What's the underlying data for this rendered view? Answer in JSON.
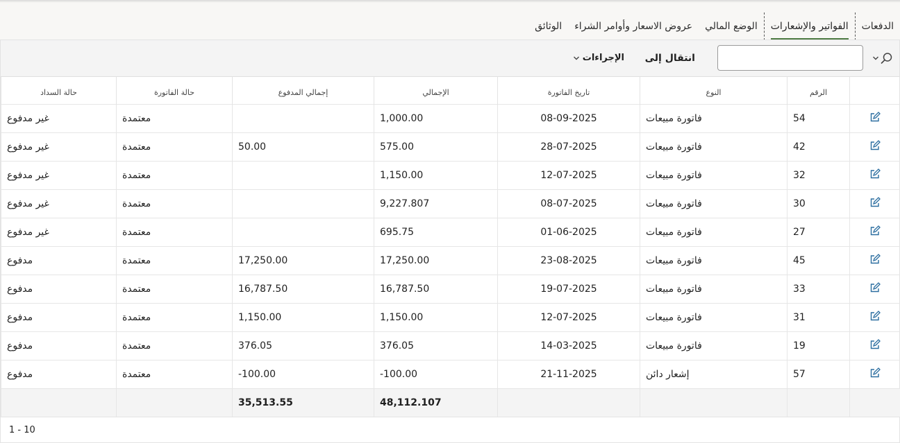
{
  "tabs": [
    {
      "label": "الدفعات",
      "active": false
    },
    {
      "label": "الفواتير والإشعارات",
      "active": true
    },
    {
      "label": "الوضع المالي",
      "active": false
    },
    {
      "label": "عروض الاسعار وأوامر الشراء",
      "active": false
    },
    {
      "label": "الوثائق",
      "active": false
    }
  ],
  "toolbar": {
    "search_value": "",
    "search_icon": "search-icon",
    "goto_label": "انتقال إلى",
    "actions_label": "الإجراءات"
  },
  "table": {
    "headers": [
      "",
      "الرقم",
      "النوع",
      "تاريخ الفاتورة",
      "الإجمالي",
      "إجمالي المدفوع",
      "حالة الفاتورة",
      "حالة السداد"
    ],
    "rows": [
      {
        "id": "54",
        "type": "فاتورة مبيعات",
        "date": "08-09-2025",
        "total": "1,000.00",
        "paid": "",
        "invoice_status": "معتمدة",
        "payment_status": "غير مدفوع"
      },
      {
        "id": "42",
        "type": "فاتورة مبيعات",
        "date": "28-07-2025",
        "total": "575.00",
        "paid": "50.00",
        "invoice_status": "معتمدة",
        "payment_status": "غير مدفوع"
      },
      {
        "id": "32",
        "type": "فاتورة مبيعات",
        "date": "12-07-2025",
        "total": "1,150.00",
        "paid": "",
        "invoice_status": "معتمدة",
        "payment_status": "غير مدفوع"
      },
      {
        "id": "30",
        "type": "فاتورة مبيعات",
        "date": "08-07-2025",
        "total": "9,227.807",
        "paid": "",
        "invoice_status": "معتمدة",
        "payment_status": "غير مدفوع"
      },
      {
        "id": "27",
        "type": "فاتورة مبيعات",
        "date": "01-06-2025",
        "total": "695.75",
        "paid": "",
        "invoice_status": "معتمدة",
        "payment_status": "غير مدفوع"
      },
      {
        "id": "45",
        "type": "فاتورة مبيعات",
        "date": "23-08-2025",
        "total": "17,250.00",
        "paid": "17,250.00",
        "invoice_status": "معتمدة",
        "payment_status": "مدفوع"
      },
      {
        "id": "33",
        "type": "فاتورة مبيعات",
        "date": "19-07-2025",
        "total": "16,787.50",
        "paid": "16,787.50",
        "invoice_status": "معتمدة",
        "payment_status": "مدفوع"
      },
      {
        "id": "31",
        "type": "فاتورة مبيعات",
        "date": "12-07-2025",
        "total": "1,150.00",
        "paid": "1,150.00",
        "invoice_status": "معتمدة",
        "payment_status": "مدفوع"
      },
      {
        "id": "19",
        "type": "فاتورة مبيعات",
        "date": "14-03-2025",
        "total": "376.05",
        "paid": "376.05",
        "invoice_status": "معتمدة",
        "payment_status": "مدفوع"
      },
      {
        "id": "57",
        "type": "إشعار دائن",
        "date": "21-11-2025",
        "total": "-100.00",
        "paid": "-100.00",
        "invoice_status": "معتمدة",
        "payment_status": "مدفوع"
      }
    ],
    "totals": {
      "total": "48,112.107",
      "paid": "35,513.55"
    }
  },
  "pagination": {
    "range": "1 - 10"
  },
  "colors": {
    "accent": "#4e7a43",
    "edit_icon": "#2c6ea0"
  }
}
